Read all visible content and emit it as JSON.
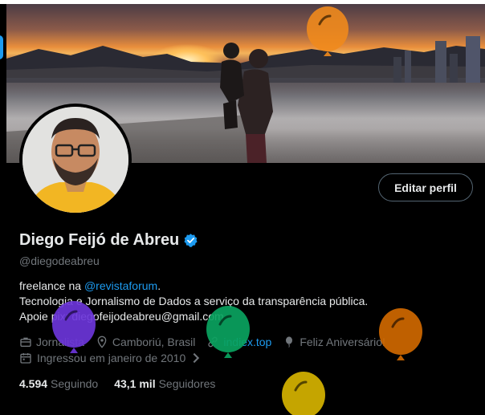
{
  "profile": {
    "name": "Diego Feijó de Abreu",
    "handle": "@diegodeabreu",
    "edit_label": "Editar perfil",
    "bio": {
      "line1_prefix": "freelance na ",
      "line1_link": "@revistaforum",
      "line1_suffix": ".",
      "line2": "Tecnologia e Jornalismo de Dados a serviço da transparência pública.",
      "line3": "Apoie pix: diegofeijodeabreu@gmail.com"
    },
    "meta": {
      "category": "Jornalista",
      "location": "Camboriú, Brasil",
      "website": "indiex.top",
      "birthday": "Feliz Aniversário!",
      "joined": "Ingressou em janeiro de 2010"
    },
    "stats": {
      "following_count": "4.594",
      "following_label": "Seguindo",
      "followers_count": "43,1 mil",
      "followers_label": "Seguidores"
    }
  },
  "icons": {
    "verified": "verified-badge-icon",
    "category": "briefcase-icon",
    "location": "location-pin-icon",
    "website": "link-icon",
    "birthday": "balloon-icon",
    "joined": "calendar-icon",
    "chevron": "chevron-right-icon"
  },
  "colors": {
    "accent": "#1d9bf0",
    "text_primary": "#e7e9ea",
    "text_secondary": "#71767b",
    "background": "#000000",
    "balloons": [
      "#f08a1c",
      "#6b35d9",
      "#0aa35f",
      "#d46a00",
      "#d6b300"
    ]
  }
}
